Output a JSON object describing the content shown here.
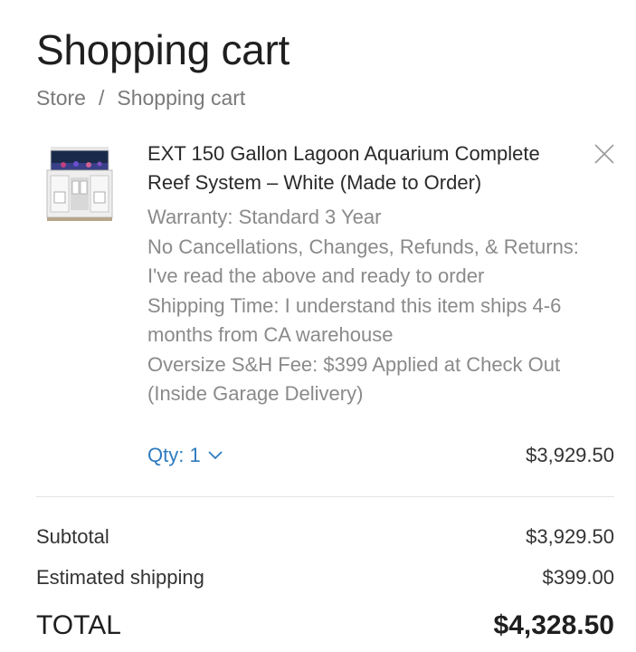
{
  "page": {
    "title": "Shopping cart"
  },
  "breadcrumb": {
    "items": [
      "Store",
      "Shopping cart"
    ],
    "separator": "/"
  },
  "cart_item": {
    "image_icon": "aquarium-product-image",
    "title": "EXT 150 Gallon Lagoon Aquarium Complete Reef System – White (Made to Order)",
    "options": [
      "Warranty: Standard 3 Year",
      "No Cancellations, Changes, Refunds, & Returns: I've read the above and ready to order",
      "Shipping Time: I understand this item ships 4-6 months from CA warehouse",
      "Oversize S&H Fee: $399 Applied at Check Out (Inside Garage Delivery)"
    ],
    "qty_label": "Qty: 1",
    "price": "$3,929.50",
    "remove_icon": "close-icon"
  },
  "summary": {
    "subtotal_label": "Subtotal",
    "subtotal_value": "$3,929.50",
    "shipping_label": "Estimated shipping",
    "shipping_value": "$399.00",
    "total_label": "TOTAL",
    "total_value": "$4,328.50"
  },
  "colors": {
    "link": "#2f7bbf",
    "muted": "#8a8a8a",
    "text": "#222222"
  }
}
